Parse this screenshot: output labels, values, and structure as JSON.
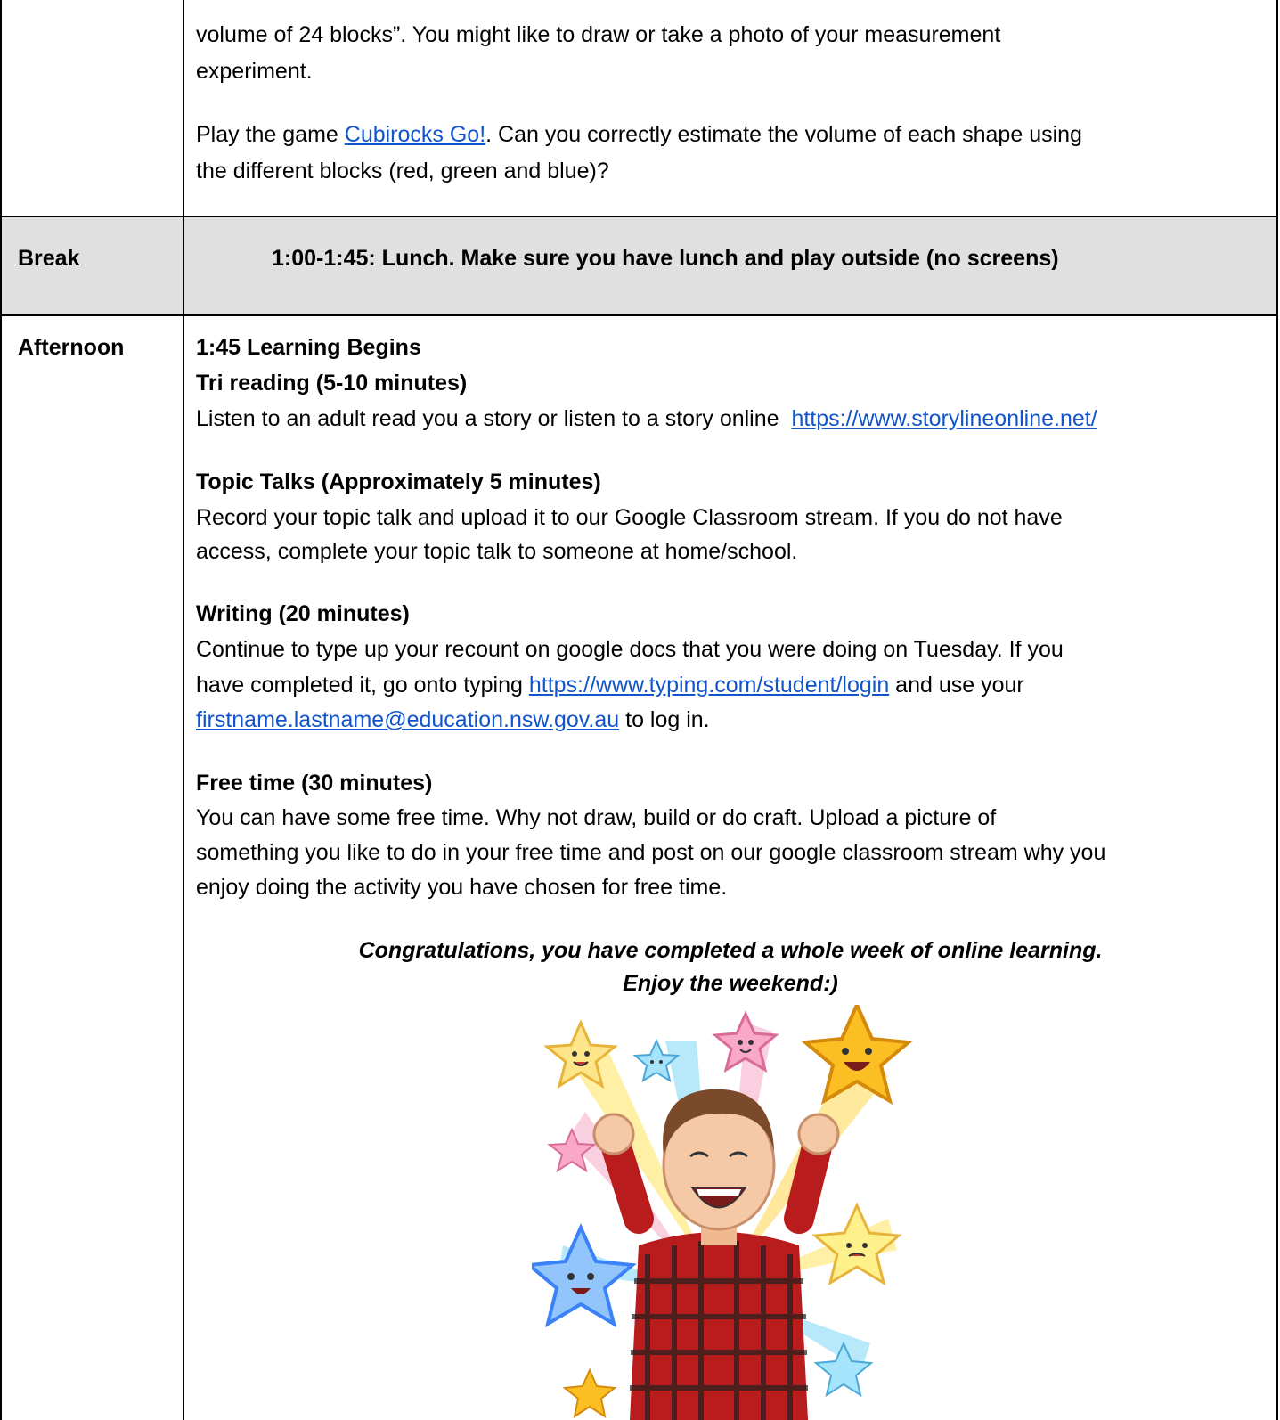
{
  "top_cell": {
    "line1": "volume of 24 blocks”. You might like to draw or take a photo of your measurement",
    "line2": "experiment.",
    "game_prefix": "Play the game ",
    "game_link": "Cubirocks Go!",
    "game_suffix": ". Can you correctly estimate the volume of each shape using",
    "line4": "the different blocks (red, green and blue)?"
  },
  "break_row": {
    "label": "Break",
    "text": "1:00-1:45: Lunch. Make sure you have lunch and play outside (no screens)",
    "band_color": "#e0e0e0"
  },
  "afternoon_row": {
    "label": "Afternoon",
    "begins": "1:45 Learning Begins",
    "reading": {
      "heading": "Tri reading (5-10 minutes)",
      "text": "Listen to an adult read you a story or listen to a story online  ",
      "link": "https://www.storylineonline.net/"
    },
    "topic": {
      "heading": "Topic Talks (Approximately 5 minutes)",
      "line1": "Record your topic talk and upload it to our Google Classroom stream. If you do not have",
      "line2": "access, complete your topic talk to someone at home/school."
    },
    "writing": {
      "heading": "Writing (20 minutes)",
      "line1": "Continue to type up your recount on google docs that you were doing on Tuesday. If you",
      "line2_prefix": "have completed it, go onto typing ",
      "line2_link": "https://www.typing.com/student/login",
      "line2_suffix": " and use your",
      "line3_link": "firstname.lastname@education.nsw.gov.au",
      "line3_suffix": " to log in."
    },
    "free_time": {
      "heading": "Free time (30 minutes)",
      "line1": "You can have some free time. Why not draw, build or do craft. Upload a picture of",
      "line2": "something you like to do in your free time and post on our google classroom stream why you",
      "line3": "enjoy doing the activity you have chosen for free time."
    },
    "congrats_line1": "Congratulations, you have completed a whole week of online learning.",
    "congrats_line2": "Enjoy the weekend:)",
    "illustration": "celebrating-character-with-stars"
  },
  "colors": {
    "link": "#1155cc",
    "border": "#000000"
  }
}
